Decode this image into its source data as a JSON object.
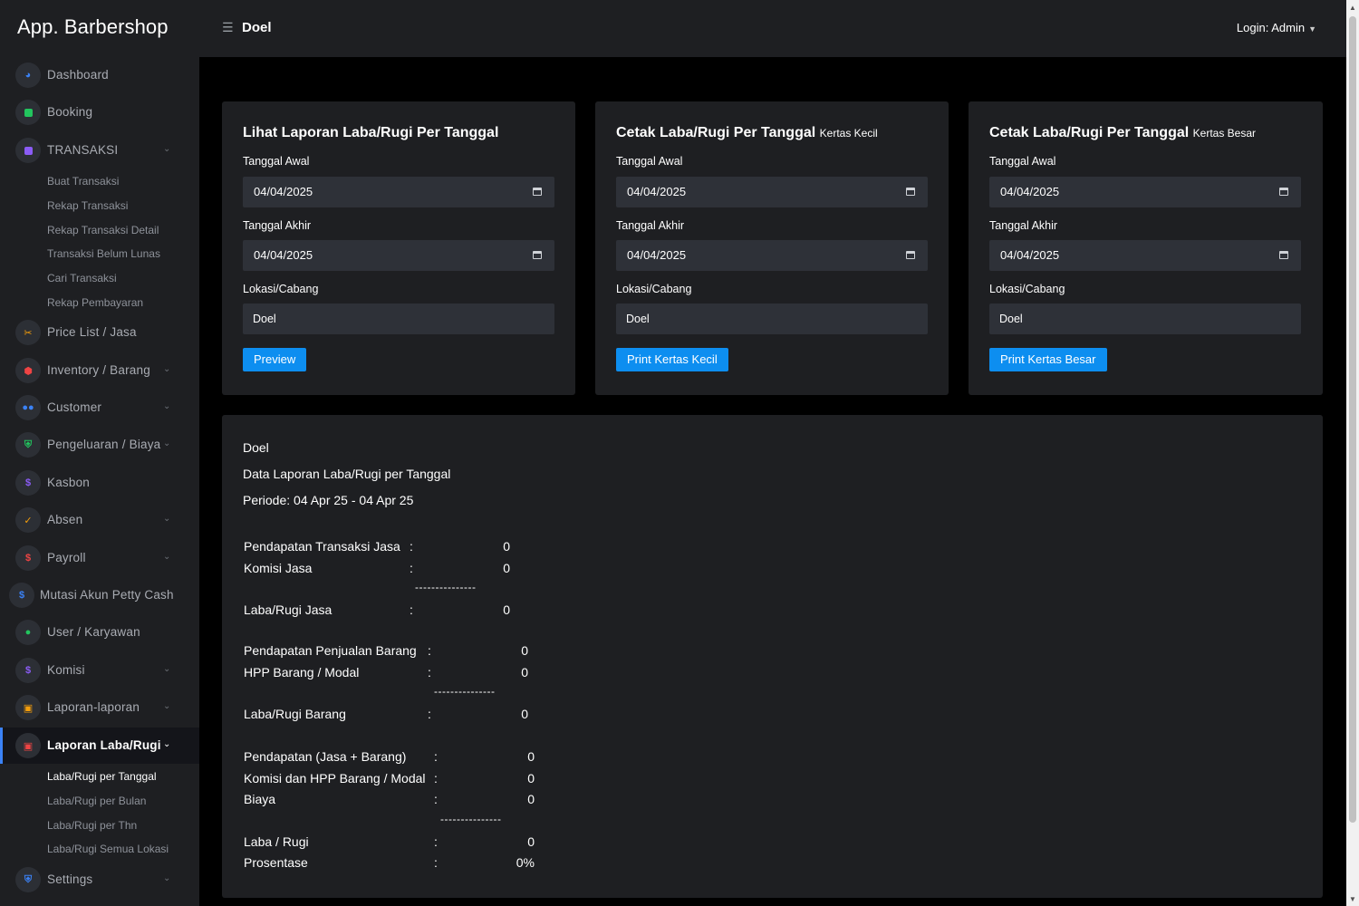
{
  "header": {
    "brand": "App. Barbershop",
    "page_title": "Doel",
    "login": "Login: Admin"
  },
  "sidebar": {
    "items": [
      {
        "label": "Dashboard",
        "icon": "dashboard-icon",
        "color": "#3b82f6"
      },
      {
        "label": "Booking",
        "icon": "booking-icon",
        "color": "#22c55e"
      },
      {
        "label": "TRANSAKSI",
        "icon": "transaction-icon",
        "color": "#8b5cf6"
      },
      {
        "label": "Price List / Jasa",
        "icon": "scissors-icon",
        "color": "#f59e0b"
      },
      {
        "label": "Inventory / Barang",
        "icon": "inventory-icon",
        "color": "#ef4444"
      },
      {
        "label": "Customer",
        "icon": "customer-icon",
        "color": "#3b82f6"
      },
      {
        "label": "Pengeluaran / Biaya",
        "icon": "expense-icon",
        "color": "#22c55e"
      },
      {
        "label": "Kasbon",
        "icon": "kasbon-icon",
        "color": "#8b5cf6"
      },
      {
        "label": "Absen",
        "icon": "check-icon",
        "color": "#f59e0b"
      },
      {
        "label": "Payroll",
        "icon": "payroll-icon",
        "color": "#ef4444"
      },
      {
        "label": "Mutasi Akun Petty Cash",
        "icon": "petty-cash-icon",
        "color": "#3b82f6"
      },
      {
        "label": "User / Karyawan",
        "icon": "user-icon",
        "color": "#22c55e"
      },
      {
        "label": "Komisi",
        "icon": "commission-icon",
        "color": "#8b5cf6"
      },
      {
        "label": "Laporan-laporan",
        "icon": "report-icon",
        "color": "#f59e0b"
      },
      {
        "label": "Laporan Laba/Rugi",
        "icon": "profit-loss-icon",
        "color": "#ef4444"
      },
      {
        "label": "Settings",
        "icon": "settings-icon",
        "color": "#3b82f6"
      }
    ],
    "transaksi_sub": [
      "Buat Transaksi",
      "Rekap Transaksi",
      "Rekap Transaksi Detail",
      "Transaksi Belum Lunas",
      "Cari Transaksi",
      "Rekap Pembayaran"
    ],
    "laba_rugi_sub": [
      "Laba/Rugi per Tanggal",
      "Laba/Rugi per Bulan",
      "Laba/Rugi per Thn",
      "Laba/Rugi Semua Lokasi"
    ]
  },
  "cards": [
    {
      "title": "Lihat Laporan Laba/Rugi Per Tanggal",
      "subtitle": "",
      "label_start": "Tanggal Awal",
      "start": "04/04/2025",
      "label_end": "Tanggal Akhir",
      "end": "04/04/2025",
      "label_loc": "Lokasi/Cabang",
      "location": "Doel",
      "button": "Preview"
    },
    {
      "title": "Cetak Laba/Rugi Per Tanggal",
      "subtitle": "Kertas Kecil",
      "label_start": "Tanggal Awal",
      "start": "04/04/2025",
      "label_end": "Tanggal Akhir",
      "end": "04/04/2025",
      "label_loc": "Lokasi/Cabang",
      "location": "Doel",
      "button": "Print Kertas Kecil"
    },
    {
      "title": "Cetak Laba/Rugi Per Tanggal",
      "subtitle": "Kertas Besar",
      "label_start": "Tanggal Awal",
      "start": "04/04/2025",
      "label_end": "Tanggal Akhir",
      "end": "04/04/2025",
      "label_loc": "Lokasi/Cabang",
      "location": "Doel",
      "button": "Print Kertas Besar"
    }
  ],
  "report": {
    "location": "Doel",
    "title": "Data Laporan Laba/Rugi per Tanggal",
    "period": "Periode: 04 Apr 25 - 04 Apr 25",
    "separator": "---------------",
    "jasa": {
      "pendapatan_label": "Pendapatan Transaksi Jasa",
      "pendapatan": "0",
      "komisi_label": "Komisi Jasa",
      "komisi": "0",
      "laba_label": "Laba/Rugi Jasa",
      "laba": "0"
    },
    "barang": {
      "pendapatan_label": "Pendapatan Penjualan Barang",
      "pendapatan": "0",
      "hpp_label": "HPP Barang / Modal",
      "hpp": "0",
      "laba_label": "Laba/Rugi Barang",
      "laba": "0"
    },
    "total": {
      "pendapatan_label": "Pendapatan (Jasa + Barang)",
      "pendapatan": "0",
      "komisi_hpp_label": "Komisi dan HPP Barang / Modal",
      "komisi_hpp": "0",
      "biaya_label": "Biaya",
      "biaya": "0",
      "laba_label": "Laba / Rugi",
      "laba": "0",
      "prosentase_label": "Prosentase",
      "prosentase": "0%"
    }
  }
}
